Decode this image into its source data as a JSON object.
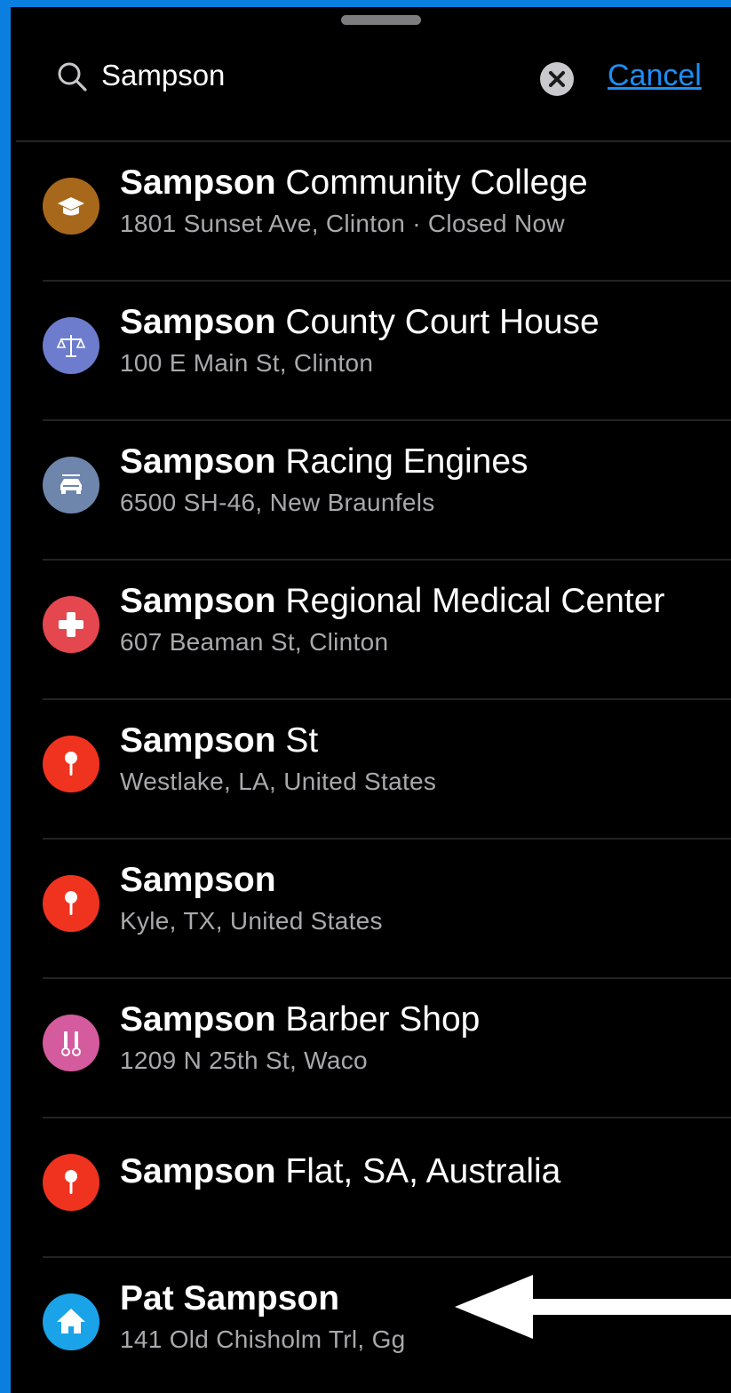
{
  "search": {
    "query": "Sampson",
    "cancel_label": "Cancel"
  },
  "results": [
    {
      "bold": "Sampson",
      "rest": "Community College",
      "subtitle": "1801 Sunset Ave, Clinton · Closed Now",
      "icon": "graduation-cap-icon",
      "color": "#a8681c"
    },
    {
      "bold": "Sampson",
      "rest": "County Court House",
      "subtitle": "100 E Main St, Clinton",
      "icon": "scales-icon",
      "color": "#6d7ccc"
    },
    {
      "bold": "Sampson",
      "rest": "Racing Engines",
      "subtitle": "6500 SH-46, New Braunfels",
      "icon": "car-icon",
      "color": "#6f86ac"
    },
    {
      "bold": "Sampson",
      "rest": "Regional Medical Center",
      "subtitle": "607 Beaman St, Clinton",
      "icon": "medical-cross-icon",
      "color": "#e5474f"
    },
    {
      "bold": "Sampson",
      "rest": "St",
      "subtitle": "Westlake, LA, United States",
      "icon": "pin-icon",
      "color": "#f0331f"
    },
    {
      "bold": "Sampson",
      "rest": "",
      "subtitle": "Kyle, TX, United States",
      "icon": "pin-icon",
      "color": "#f0331f"
    },
    {
      "bold": "Sampson",
      "rest": "Barber Shop",
      "subtitle": "1209 N 25th St, Waco",
      "icon": "barber-icon",
      "color": "#d45b9d"
    },
    {
      "bold": "Sampson",
      "rest": "Flat, SA, Australia",
      "subtitle": "",
      "icon": "pin-icon",
      "color": "#f0331f"
    },
    {
      "bold": "Pat Sampson",
      "rest": "",
      "subtitle": "141 Old Chisholm Trl, Gg",
      "icon": "home-icon",
      "color": "#1aa3e8"
    }
  ]
}
